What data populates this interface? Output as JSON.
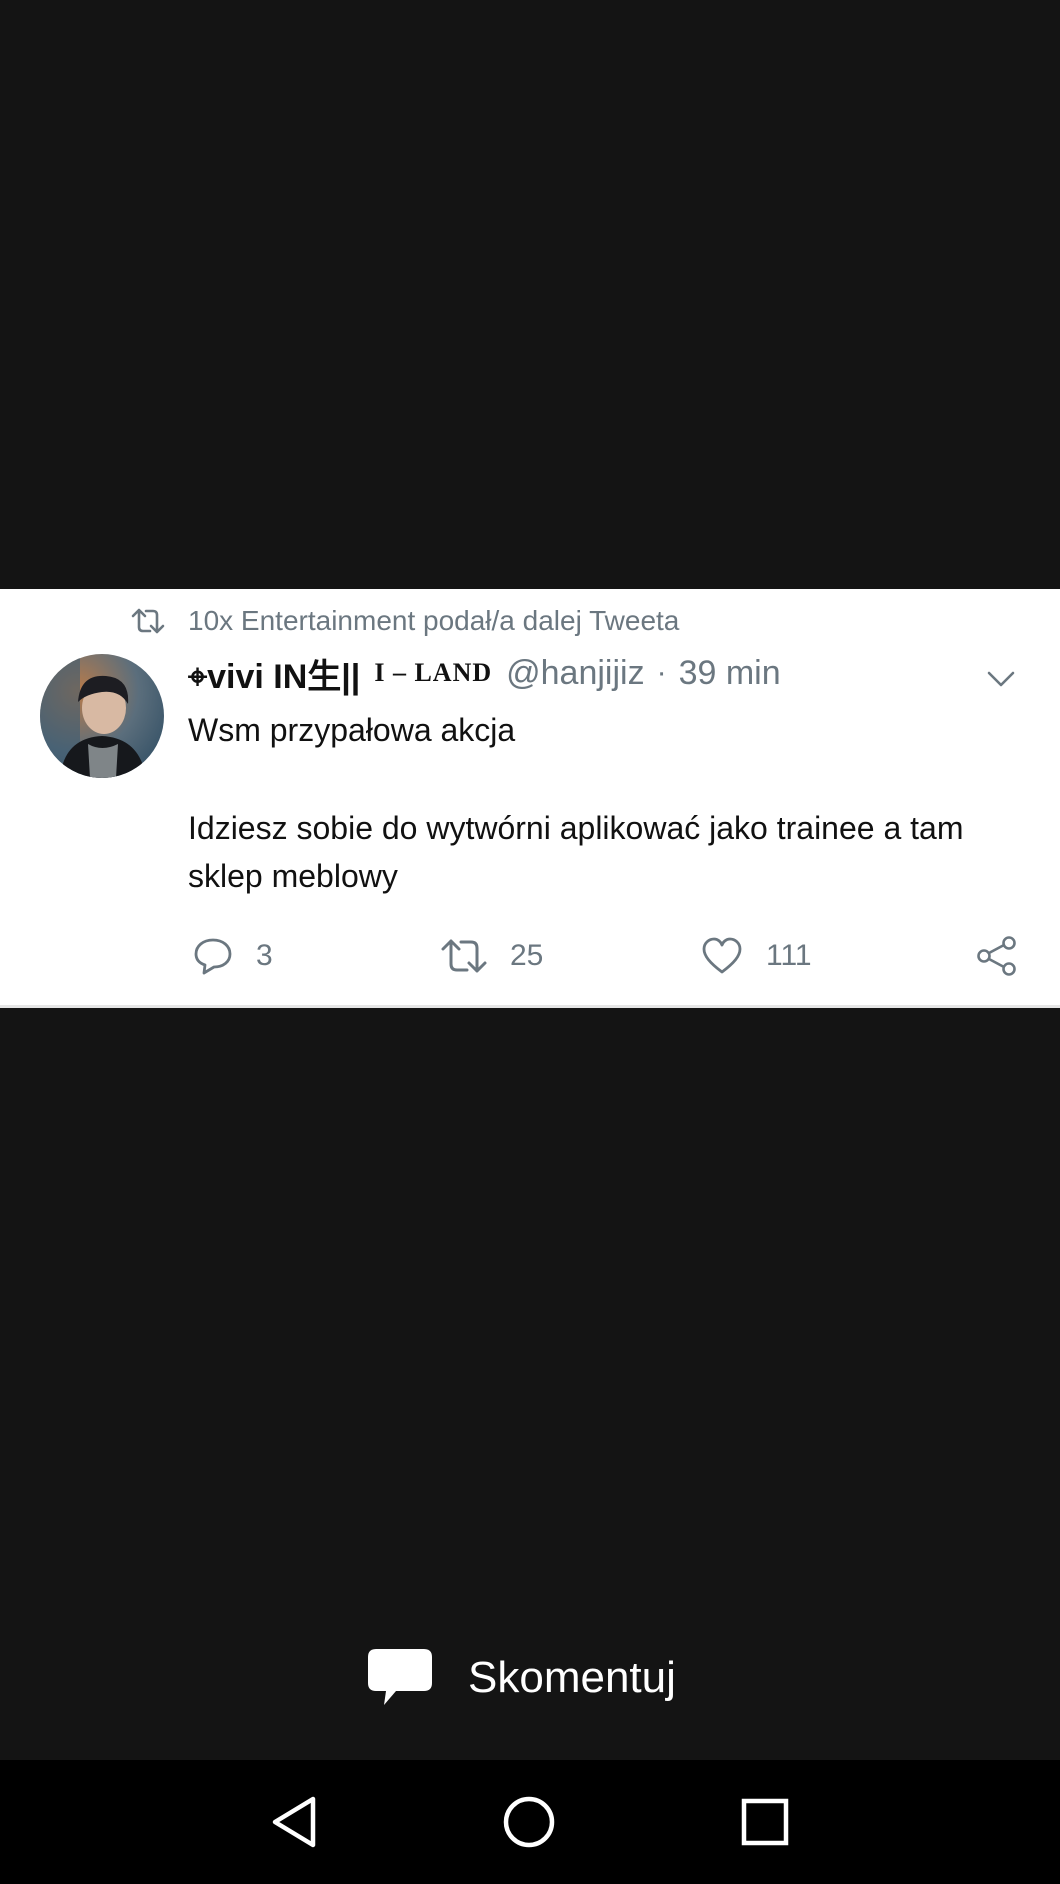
{
  "tweet": {
    "retweeted_by": "10x Entertainment podał/a dalej Tweeta",
    "display_name": "⌖vivi IN生||",
    "name_suffix": "I – LAND",
    "handle": "@hanjijiz",
    "separator": "·",
    "time": "39 min",
    "text_line1": "Wsm przypałowa akcja",
    "text_line2": "Idziesz sobie do wytwórni aplikować jako trainee a tam sklep meblowy",
    "actions": {
      "reply_count": "3",
      "retweet_count": "25",
      "like_count": "111"
    }
  },
  "comment": {
    "label": "Skomentuj",
    "icon": "speech-bubble-icon"
  },
  "nav": {
    "back_icon": "triangle-back-icon",
    "home_icon": "circle-home-icon",
    "recents_icon": "square-recents-icon"
  },
  "colors": {
    "background": "#141414",
    "card": "#ffffff",
    "muted_text": "#6b7780",
    "nav_bar": "#000000"
  }
}
